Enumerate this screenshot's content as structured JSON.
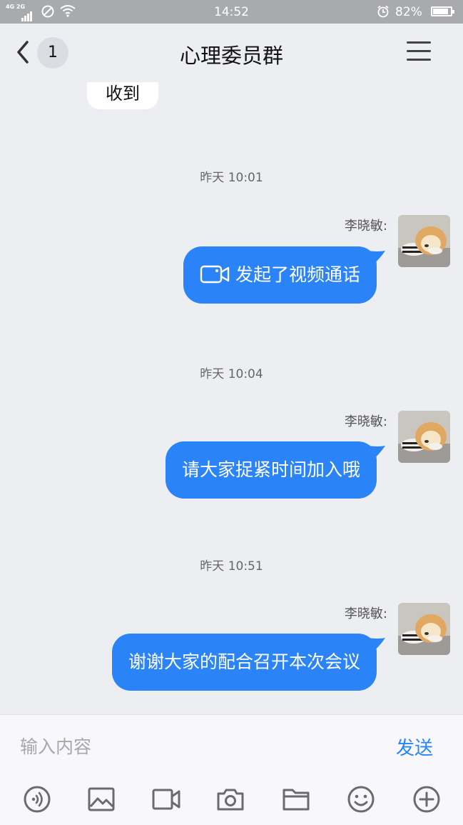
{
  "status_bar": {
    "network_label": "4G 2G",
    "time": "14:52",
    "battery_percent": "82%",
    "battery_level": 0.82
  },
  "nav": {
    "back_badge": "1",
    "title": "心理委员群"
  },
  "chat": {
    "partial_message": "收到",
    "entries": [
      {
        "timestamp": "昨天 10:01",
        "sender": "李晓敏:",
        "message": "发起了视频通话",
        "has_video_icon": true
      },
      {
        "timestamp": "昨天 10:04",
        "sender": "李晓敏:",
        "message": "请大家捉紧时间加入哦"
      },
      {
        "timestamp": "昨天 10:51",
        "sender": "李晓敏:",
        "message": "谢谢大家的配合召开本次会议"
      }
    ]
  },
  "composer": {
    "placeholder": "输入内容",
    "value": "",
    "send_label": "发送"
  },
  "toolbar_icons": [
    "voice-icon",
    "image-icon",
    "video-camera-icon",
    "camera-icon",
    "folder-icon",
    "emoji-icon",
    "plus-icon"
  ],
  "colors": {
    "accent": "#2a84f7",
    "background": "#edeef2",
    "status_bar": "#a9aaae"
  }
}
